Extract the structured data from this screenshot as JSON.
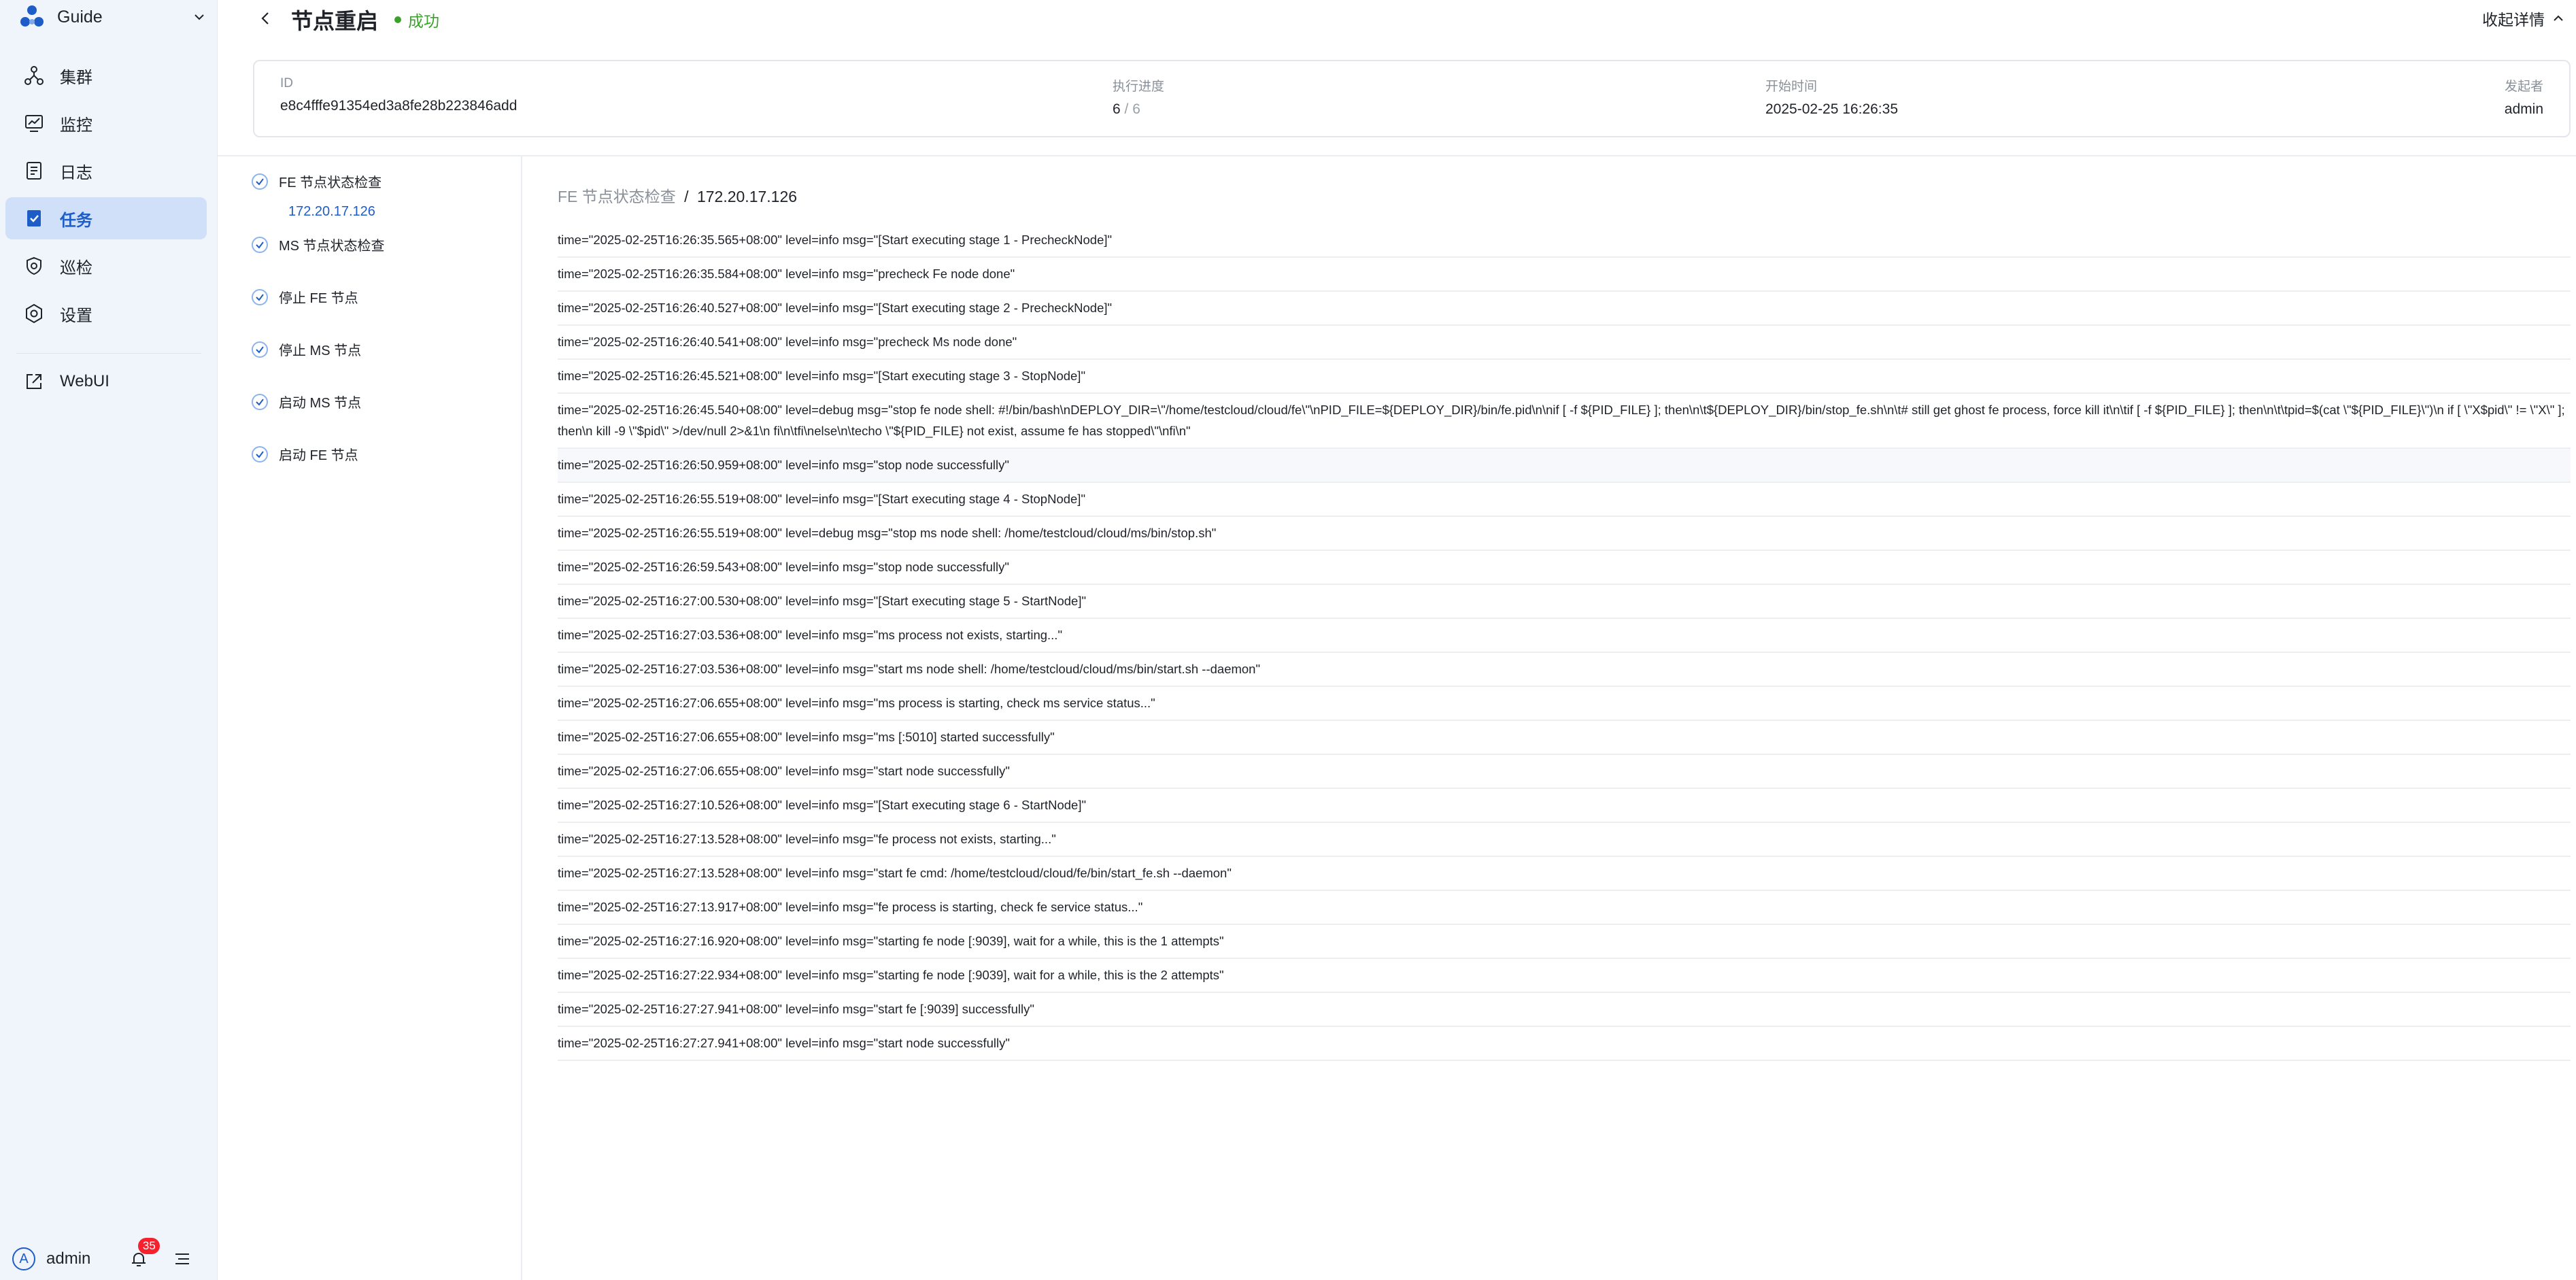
{
  "sidebar": {
    "brand": "Guide",
    "items": [
      {
        "label": "集群",
        "icon": "cluster-icon"
      },
      {
        "label": "监控",
        "icon": "monitor-icon"
      },
      {
        "label": "日志",
        "icon": "log-icon"
      },
      {
        "label": "任务",
        "icon": "task-icon",
        "active": true
      },
      {
        "label": "巡检",
        "icon": "inspection-icon"
      },
      {
        "label": "设置",
        "icon": "settings-icon"
      },
      {
        "label": "WebUI",
        "icon": "external-link-icon"
      }
    ],
    "user": {
      "avatar_letter": "A",
      "name": "admin",
      "notification_count": "35"
    }
  },
  "header": {
    "title": "节点重启",
    "status": "成功",
    "collapse_label": "收起详情"
  },
  "info": {
    "id_label": "ID",
    "id_value": "e8c4fffe91354ed3a8fe28b223846add",
    "progress_label": "执行进度",
    "progress_done": "6",
    "progress_total": "/ 6",
    "start_label": "开始时间",
    "start_value": "2025-02-25 16:26:35",
    "initiator_label": "发起者",
    "initiator_value": "admin"
  },
  "steps": [
    {
      "label": "FE 节点状态检查",
      "sub": "172.20.17.126"
    },
    {
      "label": "MS 节点状态检查"
    },
    {
      "label": "停止 FE 节点"
    },
    {
      "label": "停止 MS 节点"
    },
    {
      "label": "启动 MS 节点"
    },
    {
      "label": "启动 FE 节点"
    }
  ],
  "log": {
    "crumb_parent": "FE 节点状态检查",
    "crumb_sep": "/",
    "crumb_current": "172.20.17.126",
    "lines": [
      "time=\"2025-02-25T16:26:35.565+08:00\" level=info msg=\"[Start executing stage 1 - PrecheckNode]\"",
      "time=\"2025-02-25T16:26:35.584+08:00\" level=info msg=\"precheck Fe node done\"",
      "time=\"2025-02-25T16:26:40.527+08:00\" level=info msg=\"[Start executing stage 2 - PrecheckNode]\"",
      "time=\"2025-02-25T16:26:40.541+08:00\" level=info msg=\"precheck Ms node done\"",
      "time=\"2025-02-25T16:26:45.521+08:00\" level=info msg=\"[Start executing stage 3 - StopNode]\"",
      "time=\"2025-02-25T16:26:45.540+08:00\" level=debug msg=\"stop fe node shell: #!/bin/bash\\nDEPLOY_DIR=\\\"/home/testcloud/cloud/fe\\\"\\nPID_FILE=${DEPLOY_DIR}/bin/fe.pid\\n\\nif [ -f ${PID_FILE} ]; then\\n\\t${DEPLOY_DIR}/bin/stop_fe.sh\\n\\t# still get ghost fe process, force kill it\\n\\tif [ -f ${PID_FILE} ]; then\\n\\t\\tpid=$(cat \\\"${PID_FILE}\\\")\\n        if [ \\\"X$pid\\\" != \\\"X\\\" ]; then\\n            kill -9 \\\"$pid\\\" >/dev/null 2>&1\\n        fi\\n\\tfi\\nelse\\n\\techo \\\"${PID_FILE} not exist, assume fe has stopped\\\"\\nfi\\n\"",
      "time=\"2025-02-25T16:26:50.959+08:00\" level=info msg=\"stop node successfully\"",
      "time=\"2025-02-25T16:26:55.519+08:00\" level=info msg=\"[Start executing stage 4 - StopNode]\"",
      "time=\"2025-02-25T16:26:55.519+08:00\" level=debug msg=\"stop ms node shell: /home/testcloud/cloud/ms/bin/stop.sh\"",
      "time=\"2025-02-25T16:26:59.543+08:00\" level=info msg=\"stop node successfully\"",
      "time=\"2025-02-25T16:27:00.530+08:00\" level=info msg=\"[Start executing stage 5 - StartNode]\"",
      "time=\"2025-02-25T16:27:03.536+08:00\" level=info msg=\"ms process not exists, starting...\"",
      "time=\"2025-02-25T16:27:03.536+08:00\" level=info msg=\"start ms node shell: /home/testcloud/cloud/ms/bin/start.sh --daemon\"",
      "time=\"2025-02-25T16:27:06.655+08:00\" level=info msg=\"ms process is starting, check ms service status...\"",
      "time=\"2025-02-25T16:27:06.655+08:00\" level=info msg=\"ms [:5010] started successfully\"",
      "time=\"2025-02-25T16:27:06.655+08:00\" level=info msg=\"start node successfully\"",
      "time=\"2025-02-25T16:27:10.526+08:00\" level=info msg=\"[Start executing stage 6 - StartNode]\"",
      "time=\"2025-02-25T16:27:13.528+08:00\" level=info msg=\"fe process not exists, starting...\"",
      "time=\"2025-02-25T16:27:13.528+08:00\" level=info msg=\"start fe cmd: /home/testcloud/cloud/fe/bin/start_fe.sh --daemon\"",
      "time=\"2025-02-25T16:27:13.917+08:00\" level=info msg=\"fe process is starting, check fe service status...\"",
      "time=\"2025-02-25T16:27:16.920+08:00\" level=info msg=\"starting fe node [:9039], wait for a while, this is the 1 attempts\"",
      "time=\"2025-02-25T16:27:22.934+08:00\" level=info msg=\"starting fe node [:9039], wait for a while, this is the 2 attempts\"",
      "time=\"2025-02-25T16:27:27.941+08:00\" level=info msg=\"start fe [:9039] successfully\"",
      "time=\"2025-02-25T16:27:27.941+08:00\" level=info msg=\"start node successfully\""
    ]
  },
  "colors": {
    "accent": "#1e5dc8",
    "success": "#3aa22a",
    "sidebar_bg": "#f0f5fc",
    "active_bg": "#cfe0f8",
    "badge": "#f5222d"
  }
}
